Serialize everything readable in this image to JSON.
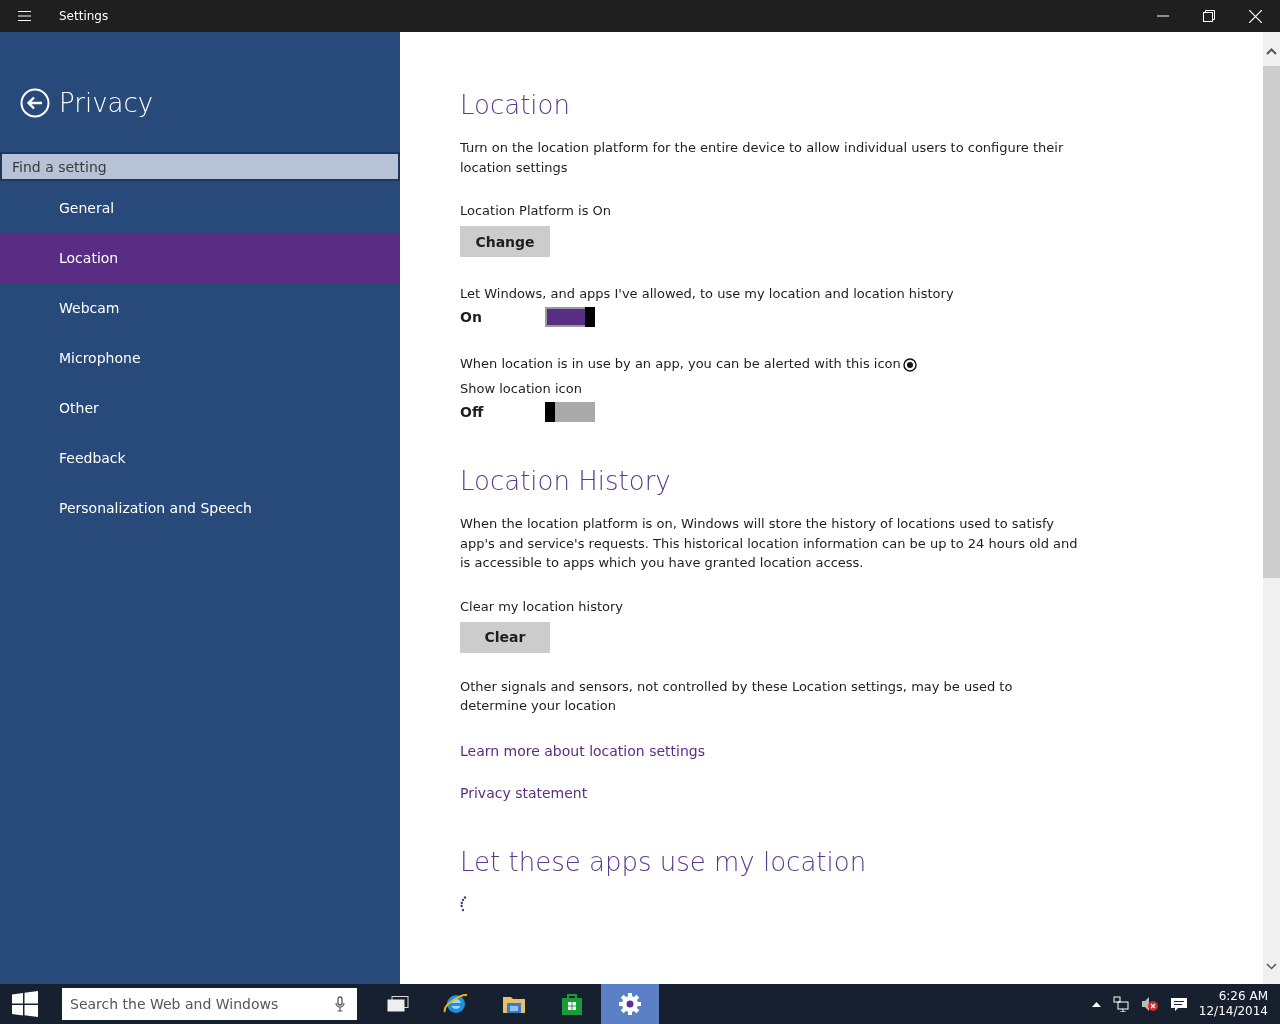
{
  "window": {
    "title": "Settings"
  },
  "sidebar": {
    "title": "Privacy",
    "search": {
      "placeholder": "Find a setting"
    },
    "items": [
      {
        "label": "General",
        "selected": false
      },
      {
        "label": "Location",
        "selected": true
      },
      {
        "label": "Webcam",
        "selected": false
      },
      {
        "label": "Microphone",
        "selected": false
      },
      {
        "label": "Other",
        "selected": false
      },
      {
        "label": "Feedback",
        "selected": false
      },
      {
        "label": "Personalization and Speech",
        "selected": false
      }
    ]
  },
  "content": [
    {
      "kind": "heading",
      "text": "Location"
    },
    {
      "kind": "paragraph",
      "text": "Turn on the location platform for the entire device to allow individual users to configure their location settings"
    },
    {
      "kind": "label",
      "text": "Location Platform is On"
    },
    {
      "kind": "button",
      "text": "Change"
    },
    {
      "kind": "label",
      "text": "Let Windows, and apps I've allowed, to use my location and location history"
    },
    {
      "kind": "toggle",
      "state_text": "On",
      "on": true
    },
    {
      "kind": "label_icon",
      "text": "When location is in use by an app, you can be alerted with this icon"
    },
    {
      "kind": "label",
      "text": "Show location icon"
    },
    {
      "kind": "toggle",
      "state_text": "Off",
      "on": false
    },
    {
      "kind": "heading",
      "text": "Location History"
    },
    {
      "kind": "paragraph",
      "text": "When the location platform is on, Windows will store the history of locations used to satisfy app's and service's requests. This historical location information can be up to 24 hours old and is accessible to apps which you have granted location access."
    },
    {
      "kind": "label",
      "text": "Clear my location history"
    },
    {
      "kind": "button",
      "text": "Clear"
    },
    {
      "kind": "paragraph",
      "text": "Other signals and sensors, not controlled by these Location settings, may be used to determine your location"
    },
    {
      "kind": "link",
      "text": "Learn more about location settings"
    },
    {
      "kind": "link",
      "text": "Privacy statement"
    },
    {
      "kind": "heading",
      "text": "Let these apps use my location"
    },
    {
      "kind": "spinner"
    }
  ],
  "taskbar": {
    "search": {
      "placeholder": "Search the Web and Windows"
    },
    "apps": [
      {
        "kind": "task_view",
        "selected": false
      },
      {
        "kind": "browser",
        "selected": false
      },
      {
        "kind": "folder",
        "selected": false
      },
      {
        "kind": "store",
        "selected": false
      },
      {
        "kind": "settings",
        "selected": true
      }
    ],
    "time": "6:26 AM",
    "date": "12/14/2014"
  }
}
